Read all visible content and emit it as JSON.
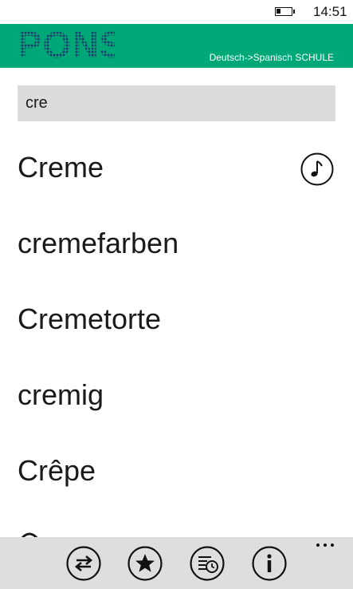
{
  "status": {
    "time": "14:51",
    "battery_level": 0.3,
    "icons": [
      "battery-icon"
    ]
  },
  "header": {
    "logo_text": "PONS",
    "dictionary": "Deutsch->Spanisch SCHULE",
    "background_color": "#00a878",
    "logo_color": "#1b3a6b"
  },
  "search": {
    "value": "cre",
    "background_color": "#dcdcdc"
  },
  "results": [
    {
      "word": "Creme",
      "has_audio": true
    },
    {
      "word": "cremefarben",
      "has_audio": false
    },
    {
      "word": "Cremetorte",
      "has_audio": false
    },
    {
      "word": "cremig",
      "has_audio": false
    },
    {
      "word": "Crêpe",
      "has_audio": false
    }
  ],
  "appbar": {
    "buttons": [
      {
        "icon": "swap-direction-icon"
      },
      {
        "icon": "star-icon"
      },
      {
        "icon": "history-icon"
      },
      {
        "icon": "info-icon"
      }
    ],
    "more_icon": "more-dots-icon",
    "background_color": "#dedede"
  }
}
